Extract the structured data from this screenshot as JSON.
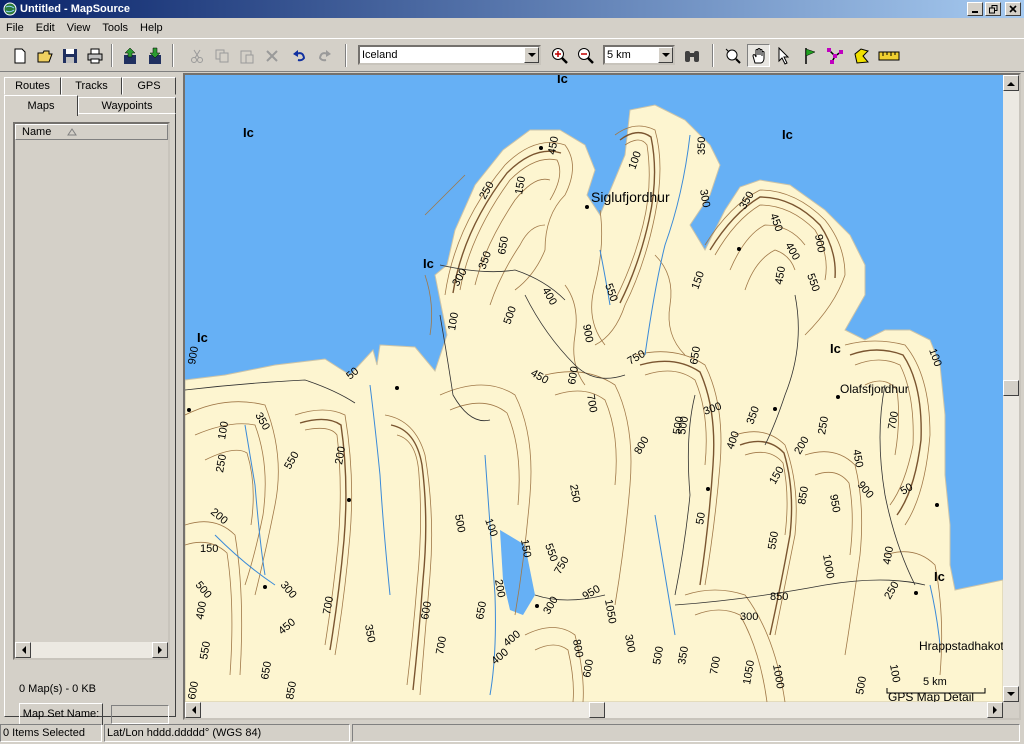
{
  "window": {
    "title": "Untitled - MapSource"
  },
  "menu": [
    "File",
    "Edit",
    "View",
    "Tools",
    "Help"
  ],
  "toolbar": {
    "map_product": "Iceland",
    "zoom_scale": "5 km"
  },
  "left_panel": {
    "tabs_row1": [
      "Routes",
      "Tracks",
      "GPS"
    ],
    "tabs_row2": [
      "Maps",
      "Waypoints"
    ],
    "active_tab": "Maps",
    "column_header": "Name",
    "map_count": "0 Map(s) - 0 KB",
    "map_set_button": "Map Set Name:"
  },
  "map": {
    "labels": {
      "town1": "Siglufjordhur",
      "town2": "Olafsfjordhur",
      "place3": "Hrappstadhakot",
      "ice": "Ic"
    },
    "contours": [
      "450",
      "250",
      "150",
      "650",
      "350",
      "300",
      "100",
      "500",
      "400",
      "550",
      "900",
      "700",
      "600",
      "200",
      "800",
      "750",
      "850",
      "50",
      "950",
      "1000",
      "1050"
    ],
    "scale_label": "5 km",
    "detail_label": "GPS Map Detail"
  },
  "status": {
    "selection": "0 Items Selected",
    "position_format": "Lat/Lon hddd.ddddd° (WGS 84)"
  },
  "colors": {
    "water": "#66b0f5",
    "land": "#fdf5d0",
    "contour": "#a07848",
    "stream": "#3a8ad8",
    "titlebar": "#0a246a"
  }
}
